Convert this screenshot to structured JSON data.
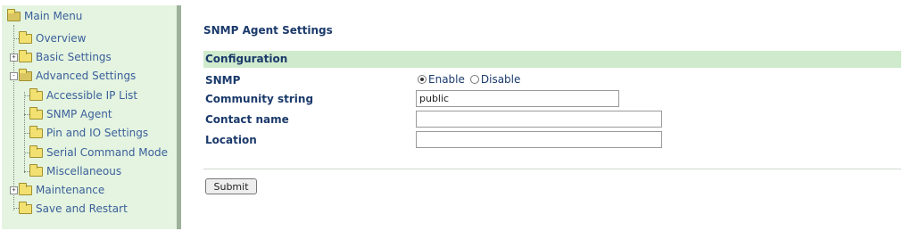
{
  "sidebar": {
    "root": "Main Menu",
    "items": [
      {
        "label": "Overview"
      },
      {
        "label": "Basic Settings",
        "expander": "+"
      },
      {
        "label": "Advanced Settings",
        "expander": "-"
      },
      {
        "label": "Accessible IP List"
      },
      {
        "label": "SNMP Agent"
      },
      {
        "label": "Pin and IO Settings"
      },
      {
        "label": "Serial Command Mode"
      },
      {
        "label": "Miscellaneous"
      },
      {
        "label": "Maintenance",
        "expander": "+"
      },
      {
        "label": "Save and Restart"
      }
    ]
  },
  "main": {
    "title": "SNMP Agent Settings",
    "section": "Configuration",
    "snmp": {
      "label": "SNMP",
      "enable": "Enable",
      "disable": "Disable",
      "selected": "Enable"
    },
    "community": {
      "label": "Community string",
      "value": "public"
    },
    "contact": {
      "label": "Contact name",
      "value": ""
    },
    "location": {
      "label": "Location",
      "value": ""
    },
    "submit": "Submit"
  }
}
